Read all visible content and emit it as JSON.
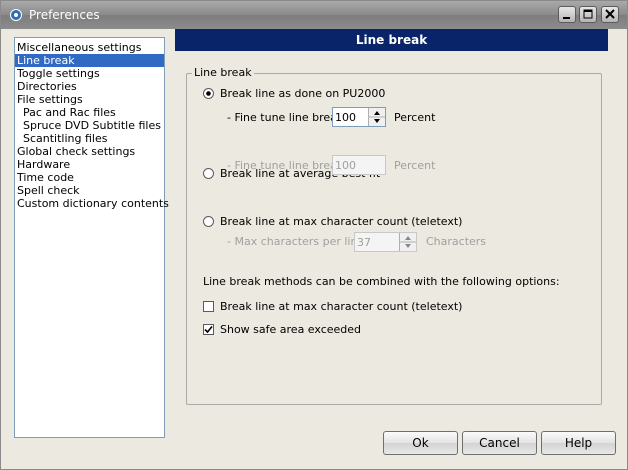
{
  "window": {
    "title": "Preferences"
  },
  "nav": {
    "items": [
      {
        "label": "Miscellaneous settings",
        "indent": false,
        "selected": false
      },
      {
        "label": "Line break",
        "indent": false,
        "selected": true
      },
      {
        "label": "Toggle settings",
        "indent": false,
        "selected": false
      },
      {
        "label": "Directories",
        "indent": false,
        "selected": false
      },
      {
        "label": "File settings",
        "indent": false,
        "selected": false
      },
      {
        "label": "Pac and Rac files",
        "indent": true,
        "selected": false
      },
      {
        "label": "Spruce DVD Subtitle files",
        "indent": true,
        "selected": false
      },
      {
        "label": "Scantitling files",
        "indent": true,
        "selected": false
      },
      {
        "label": "Global check settings",
        "indent": false,
        "selected": false
      },
      {
        "label": "Hardware",
        "indent": false,
        "selected": false
      },
      {
        "label": "Time code",
        "indent": false,
        "selected": false
      },
      {
        "label": "Spell check",
        "indent": false,
        "selected": false
      },
      {
        "label": "Custom dictionary contents",
        "indent": false,
        "selected": false
      }
    ]
  },
  "panel": {
    "header": "Line break",
    "group_label": "Line break",
    "opt1": {
      "label": "Break line as done on PU2000",
      "checked": true,
      "fine_label": "- Fine tune line brea",
      "fine_value": "100",
      "unit": "Percent"
    },
    "opt2": {
      "label": "Break line at average best fit",
      "checked": false,
      "fine_label": "- Fine tune line brea",
      "fine_value": "100",
      "unit": "Percent"
    },
    "opt3": {
      "label": "Break line at max character count (teletext)",
      "checked": false,
      "max_label": "- Max characters per line",
      "max_value": "37",
      "unit": "Characters"
    },
    "combine_text": "Line break methods can be combined with the following options:",
    "chk1": {
      "label": "Break line at max character count (teletext)",
      "checked": false
    },
    "chk2": {
      "label": "Show safe area exceeded",
      "checked": true
    }
  },
  "buttons": {
    "ok": "Ok",
    "cancel": "Cancel",
    "help": "Help"
  }
}
